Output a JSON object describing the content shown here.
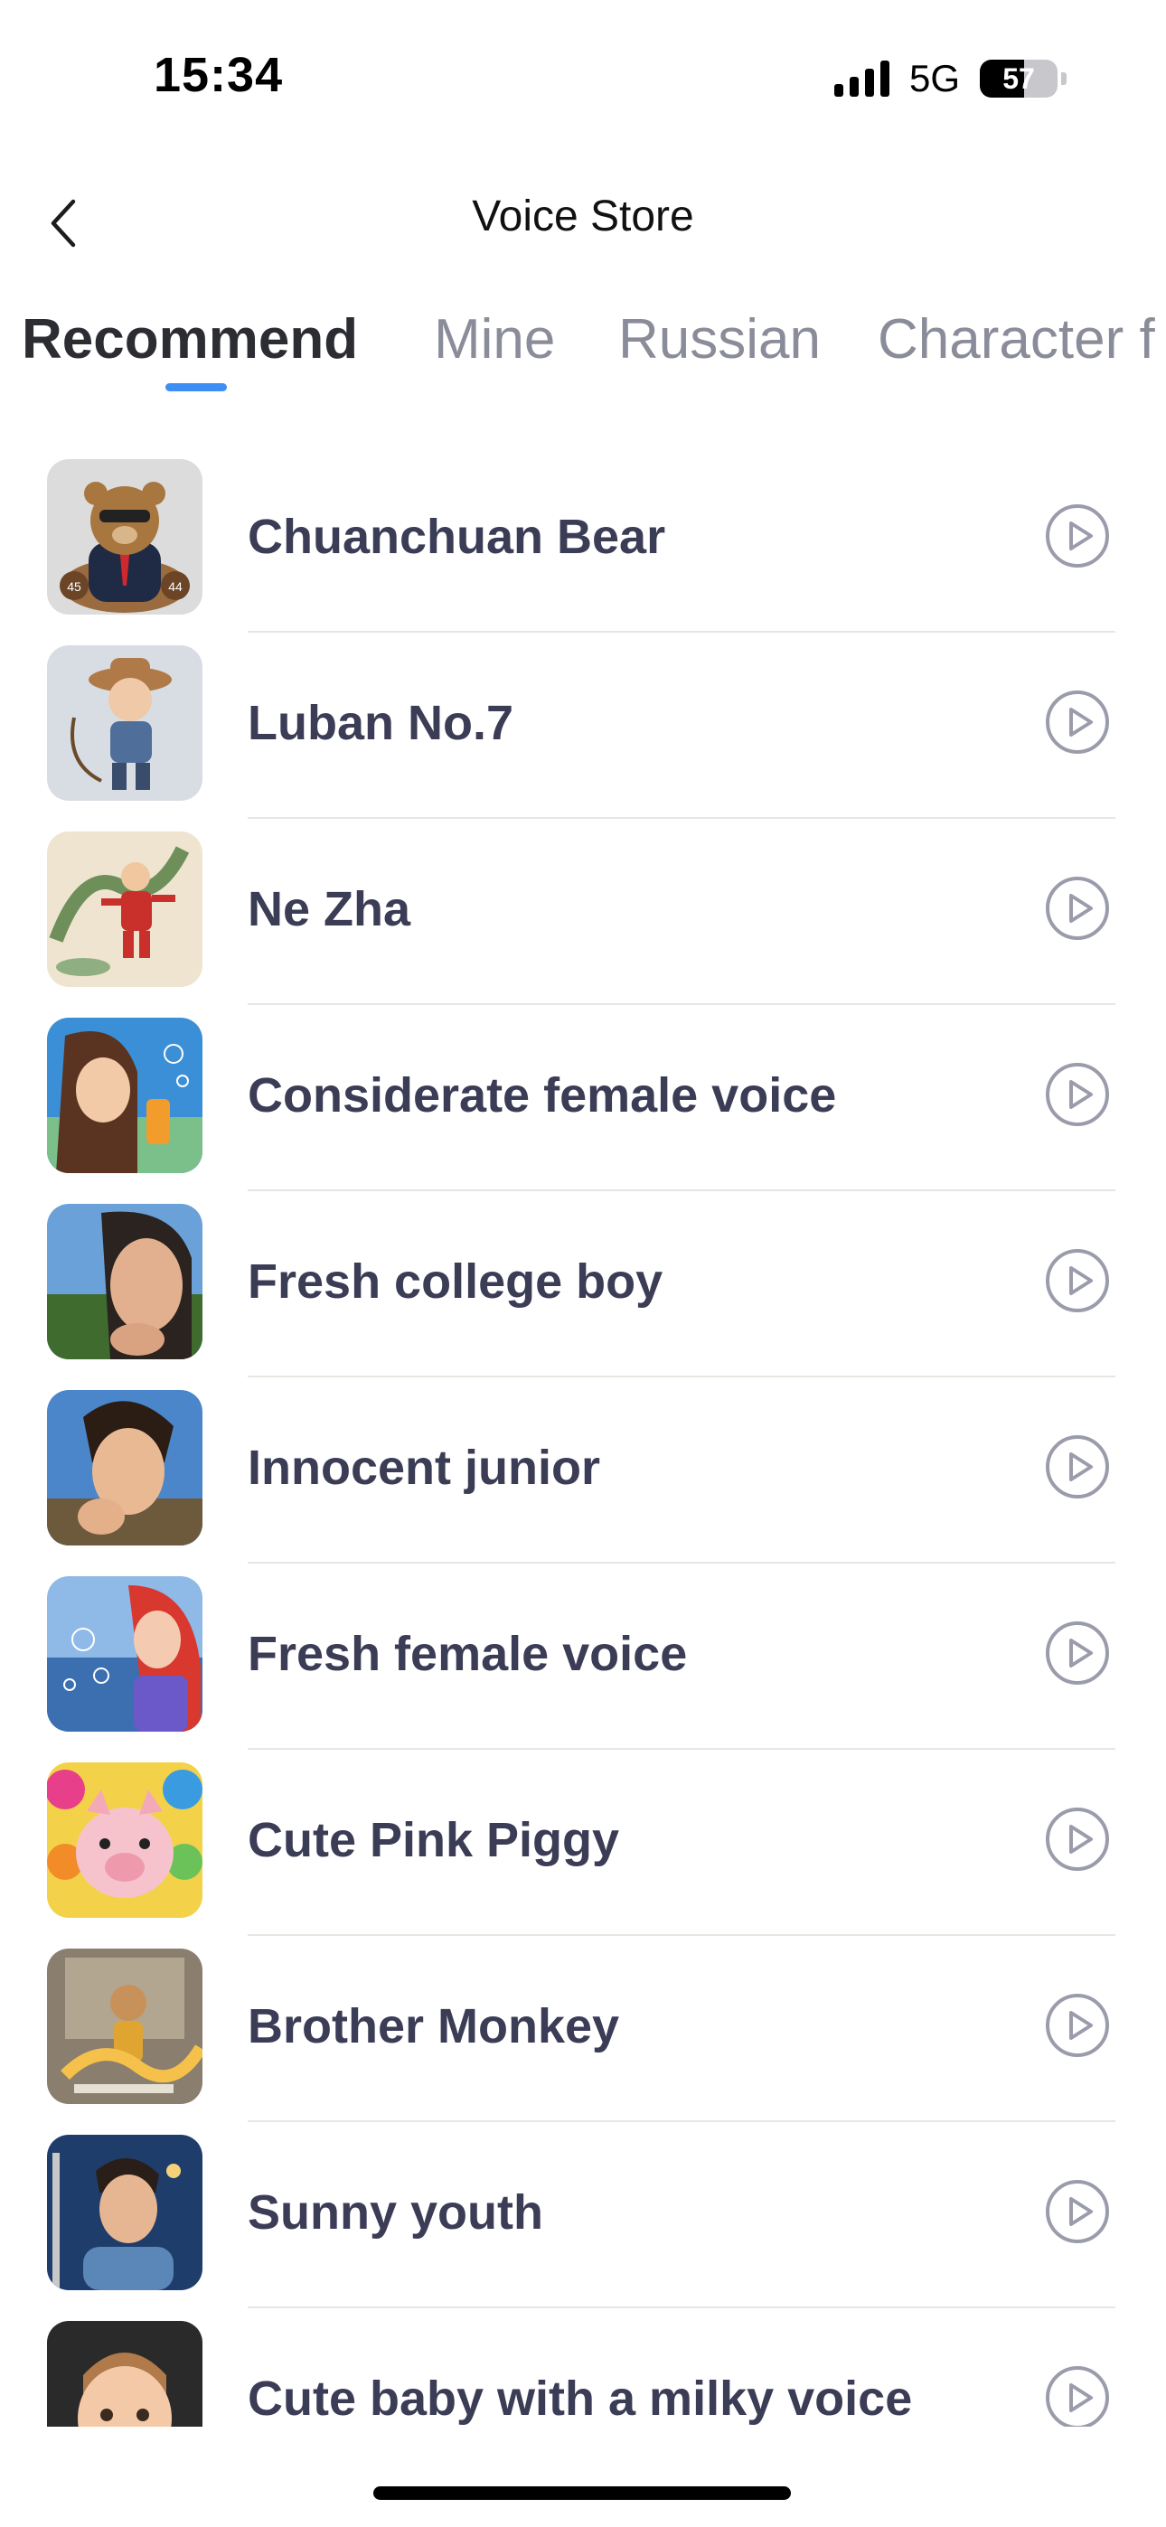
{
  "status_bar": {
    "time": "15:34",
    "network": "5G",
    "battery": "57",
    "battery_level_percent": 57
  },
  "nav": {
    "title": "Voice Store",
    "back_icon": "chevron-left-icon"
  },
  "tabs": [
    {
      "label": "Recommend",
      "active": true
    },
    {
      "label": "Mine",
      "active": false
    },
    {
      "label": "Russian",
      "active": false
    },
    {
      "label": "Character f",
      "active": false
    }
  ],
  "voices": [
    {
      "name": "Chuanchuan Bear",
      "avatar": "teddy-bear-in-suit"
    },
    {
      "name": "Luban No.7",
      "avatar": "cowboy-boy-figure"
    },
    {
      "name": "Ne Zha",
      "avatar": "ne-zha-with-dragon"
    },
    {
      "name": "Considerate female voice",
      "avatar": "girl-with-drink"
    },
    {
      "name": "Fresh college boy",
      "avatar": "young-man-portrait"
    },
    {
      "name": "Innocent junior",
      "avatar": "curly-haired-boy"
    },
    {
      "name": "Fresh female voice",
      "avatar": "red-haired-girl-bubbles"
    },
    {
      "name": "Cute Pink Piggy",
      "avatar": "pink-piggy-balloons"
    },
    {
      "name": "Brother Monkey",
      "avatar": "monkey-king"
    },
    {
      "name": "Sunny youth",
      "avatar": "boy-in-blue-shirt"
    },
    {
      "name": "Cute baby with a milky voice",
      "avatar": "baby-portrait"
    }
  ],
  "play_icon": "play-circle-icon",
  "colors": {
    "tab_indicator": "#3d8ef5",
    "item_text": "#3b3c55",
    "inactive_tab": "#8a8c99",
    "play_icon": "#9a9cab"
  }
}
